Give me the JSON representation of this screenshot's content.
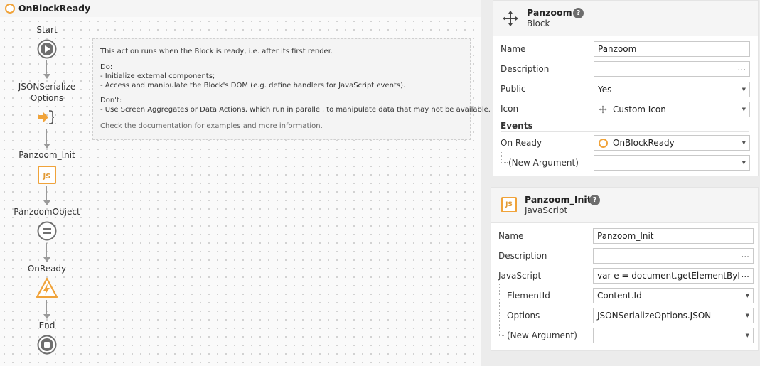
{
  "flow": {
    "title": "OnBlockReady",
    "nodes": [
      {
        "label": "Start",
        "icon": "start-play-icon"
      },
      {
        "label": "JSONSerialize\nOptions",
        "icon": "json-serialize-icon"
      },
      {
        "label": "Panzoom_Init",
        "icon": "javascript-icon"
      },
      {
        "label": "PanzoomObject",
        "icon": "assign-icon"
      },
      {
        "label": "OnReady",
        "icon": "trigger-event-icon"
      },
      {
        "label": "End",
        "icon": "end-stop-icon"
      }
    ],
    "comment": [
      "This action runs when the Block is ready, i.e. after its first render.",
      "Do:",
      "- Initialize external components;",
      "- Access and manipulate the Block's DOM (e.g. define handlers for JavaScript events).",
      "Don't:",
      "- Use Screen Aggregates or Data Actions, which run in parallel, to manipulate data that may not be available.",
      "Check the documentation for examples and more information."
    ]
  },
  "block_props": {
    "title": "Panzoom",
    "subtitle": "Block",
    "help": "?",
    "rows": {
      "name": {
        "label": "Name",
        "value": "Panzoom"
      },
      "description": {
        "label": "Description",
        "value": ""
      },
      "public": {
        "label": "Public",
        "value": "Yes"
      },
      "icon": {
        "label": "Icon",
        "value": "Custom Icon"
      }
    },
    "events_label": "Events",
    "on_ready": {
      "label": "On Ready",
      "value": "OnBlockReady"
    },
    "new_argument": {
      "label": "(New Argument)",
      "value": ""
    }
  },
  "js_props": {
    "title": "Panzoom_Init",
    "subtitle": "JavaScript",
    "help": "?",
    "icon_text": "JS",
    "rows": {
      "name": {
        "label": "Name",
        "value": "Panzoom_Init"
      },
      "description": {
        "label": "Description",
        "value": ""
      },
      "javascript": {
        "label": "JavaScript",
        "value": "var e = document.getElementByI ↵"
      },
      "element_id": {
        "label": "ElementId",
        "value": "Content.Id"
      },
      "options": {
        "label": "Options",
        "value": "JSONSerializeOptions.JSON"
      },
      "new_argument": {
        "label": "(New Argument)",
        "value": ""
      }
    }
  },
  "colors": {
    "accent_orange": "#f0a33a",
    "node_gray": "#6f6f6f"
  }
}
